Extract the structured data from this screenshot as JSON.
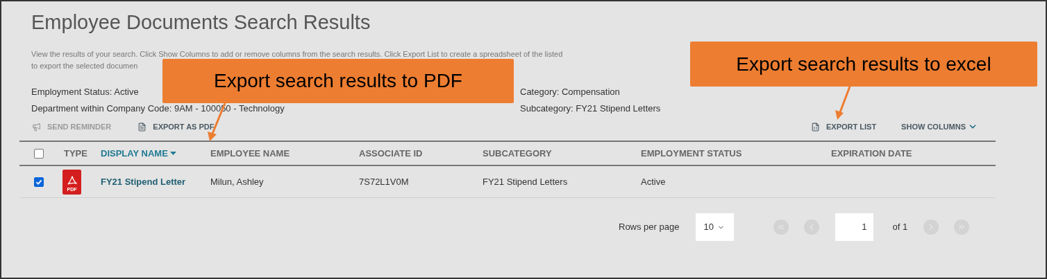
{
  "title": "Employee Documents Search Results",
  "description": [
    "View the results of your search. Click Show Columns to add or remove columns from the search results. Click Export List to create a spreadsheet of the listed",
    "to export the selected documen"
  ],
  "filters_left": [
    "Employment Status: Active",
    "Department within Company Code: 9AM - 100050 - Technology"
  ],
  "filters_right": [
    "Category: Compensation",
    "Subcategory: FY21 Stipend Letters"
  ],
  "toolbar": {
    "send_reminder": {
      "label": "SEND REMINDER",
      "disabled": true
    },
    "export_pdf": {
      "label": "EXPORT AS PDF",
      "disabled": false
    },
    "export_list": {
      "label": "EXPORT LIST"
    },
    "show_columns": {
      "label": "SHOW COLUMNS"
    }
  },
  "table": {
    "select_all": {
      "checked": false
    },
    "columns": [
      {
        "label": "TYPE",
        "sortable": false
      },
      {
        "label": "DISPLAY NAME",
        "sortable": true
      },
      {
        "label": "EMPLOYEE NAME",
        "sortable": false
      },
      {
        "label": "ASSOCIATE ID",
        "sortable": false
      },
      {
        "label": "SUBCATEGORY",
        "sortable": false
      },
      {
        "label": "EMPLOYMENT STATUS",
        "sortable": false
      },
      {
        "label": "EXPIRATION DATE",
        "sortable": false
      }
    ],
    "rows": [
      {
        "checked": true,
        "type_label": "PDF",
        "display_name": "FY21 Stipend Letter",
        "employee_name": "Milun, Ashley",
        "associate_id": "7S72L1V0M",
        "subcategory": "FY21 Stipend Letters",
        "employment_status": "Active"
      }
    ]
  },
  "pagination": {
    "rows_label": "Rows per page",
    "rows_value": "10",
    "page": "1",
    "of": "of 1"
  },
  "callouts": [
    {
      "text": "Export search results to PDF"
    },
    {
      "text": "Export search results to excel"
    }
  ]
}
